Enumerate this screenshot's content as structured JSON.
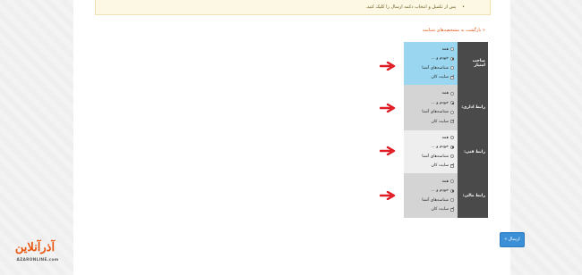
{
  "notice": {
    "bullet": "•",
    "text": "پس از تکمیل و انتخاب دکمه ارسال را کلیک کنید."
  },
  "back_link": "« بازگشت به مشخصه‌های شناسه",
  "roles": [
    {
      "label": "صاحب امتیاز",
      "highlight": "#9ad6ef",
      "options": [
        {
          "label": "همه",
          "type": "radio",
          "checked": false
        },
        {
          "label": "خودم و ...",
          "type": "radio",
          "checked": true
        },
        {
          "label": "شناسه‌های آشنا",
          "type": "radio",
          "checked": false
        },
        {
          "label": "سایت کان",
          "type": "check",
          "checked": true
        }
      ]
    },
    {
      "label": "رابط اداری:",
      "highlight": "#d4d4d4",
      "options": [
        {
          "label": "همه",
          "type": "radio",
          "checked": false
        },
        {
          "label": "خودم و ...",
          "type": "radio",
          "checked": true
        },
        {
          "label": "شناسه‌های آشنا",
          "type": "radio",
          "checked": false
        },
        {
          "label": "سایت کان",
          "type": "check",
          "checked": true
        }
      ]
    },
    {
      "label": "رابط فنی:",
      "highlight": "#eeeeee",
      "options": [
        {
          "label": "همه",
          "type": "radio",
          "checked": false
        },
        {
          "label": "خودم و ...",
          "type": "radio",
          "checked": true
        },
        {
          "label": "شناسه‌های آشنا",
          "type": "radio",
          "checked": false
        },
        {
          "label": "سایت کان",
          "type": "check",
          "checked": true
        }
      ]
    },
    {
      "label": "رابط مالی:",
      "highlight": "#d4d4d4",
      "options": [
        {
          "label": "همه",
          "type": "radio",
          "checked": false
        },
        {
          "label": "خودم و ...",
          "type": "radio",
          "checked": true
        },
        {
          "label": "شناسه‌های آشنا",
          "type": "radio",
          "checked": false
        },
        {
          "label": "سایت کان",
          "type": "check",
          "checked": true
        }
      ]
    }
  ],
  "submit_label": "ارسال »",
  "logo": {
    "main": "آذرآنلاین",
    "sub": "AZARONLINE.com"
  },
  "colors": {
    "arrow": "#e01b24",
    "accent": "#e05a1a",
    "submit": "#3a8fd6",
    "label_bg": "#4a4a4a"
  }
}
